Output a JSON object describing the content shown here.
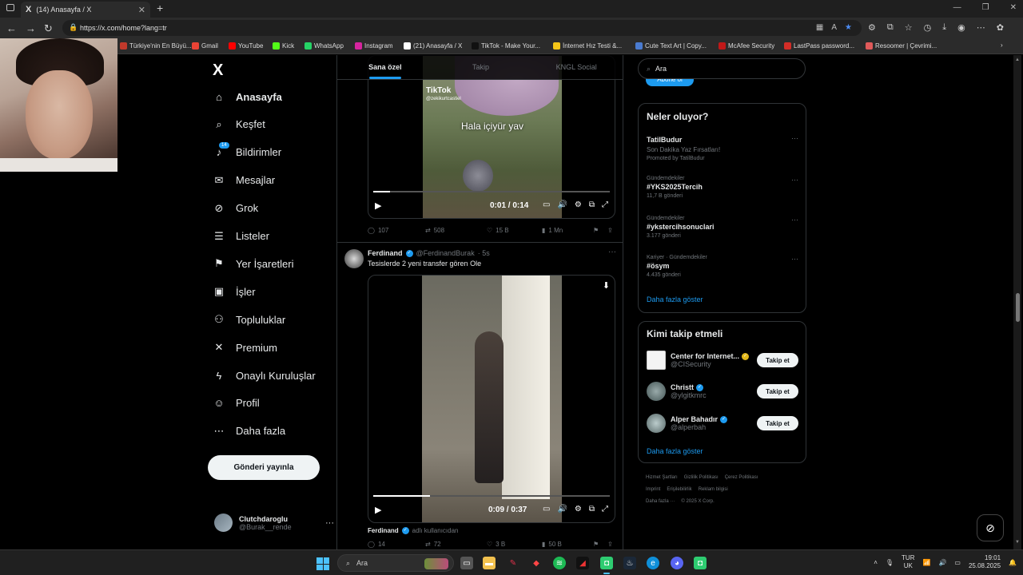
{
  "browser": {
    "tab_title": "(14) Anasayfa / X",
    "url": "https://x.com/home?lang=tr",
    "bookmarks": [
      {
        "label": "Türkiye'nin En Büyü...",
        "color": "#c0392b"
      },
      {
        "label": "Gmail",
        "color": "#ea4335"
      },
      {
        "label": "YouTube",
        "color": "#ff0000"
      },
      {
        "label": "Kick",
        "color": "#53fc18"
      },
      {
        "label": "WhatsApp",
        "color": "#25d366"
      },
      {
        "label": "Instagram",
        "color": "#d6249f"
      },
      {
        "label": "(21) Anasayfa / X",
        "color": "#ffffff"
      },
      {
        "label": "TikTok - Make Your...",
        "color": "#111111"
      },
      {
        "label": "İnternet Hız Testi &...",
        "color": "#f5c518"
      },
      {
        "label": "Cute Text Art | Copy...",
        "color": "#4a7bd0"
      },
      {
        "label": "McAfee Security",
        "color": "#c01818"
      },
      {
        "label": "LastPass password...",
        "color": "#d32d27"
      },
      {
        "label": "Resoomer | Çevrimi...",
        "color": "#e05a5a"
      }
    ]
  },
  "sidebar": {
    "logo": "X",
    "notification_count": "14",
    "items": [
      {
        "label": "Anasayfa",
        "icon": "home-icon",
        "glyph": "⌂"
      },
      {
        "label": "Keşfet",
        "icon": "search-icon",
        "glyph": "⌕"
      },
      {
        "label": "Bildirimler",
        "icon": "bell-icon",
        "glyph": "♪"
      },
      {
        "label": "Mesajlar",
        "icon": "mail-icon",
        "glyph": "✉"
      },
      {
        "label": "Grok",
        "icon": "grok-icon",
        "glyph": "⊘"
      },
      {
        "label": "Listeler",
        "icon": "list-icon",
        "glyph": "☰"
      },
      {
        "label": "Yer İşaretleri",
        "icon": "bookmark-icon",
        "glyph": "⚑"
      },
      {
        "label": "İşler",
        "icon": "briefcase-icon",
        "glyph": "▣"
      },
      {
        "label": "Topluluklar",
        "icon": "communities-icon",
        "glyph": "⚇"
      },
      {
        "label": "Premium",
        "icon": "x-premium-icon",
        "glyph": "✕"
      },
      {
        "label": "Onaylı Kuruluşlar",
        "icon": "lightning-icon",
        "glyph": "ϟ"
      },
      {
        "label": "Profil",
        "icon": "profile-icon",
        "glyph": "☺"
      },
      {
        "label": "Daha fazla",
        "icon": "more-circle-icon",
        "glyph": "⋯"
      }
    ],
    "post_button": "Gönderi yayınla",
    "account": {
      "name": "Clutchdaroglu",
      "handle": "@Burak__rende"
    }
  },
  "feed": {
    "tabs": [
      "Sana özel",
      "Takip",
      "KNGL Social"
    ],
    "post1": {
      "tiktok_label": "TikTok",
      "tiktok_handle": "@zekikurtcastiel",
      "caption": "Hala içiyür yav",
      "time": "0:01 / 0:14",
      "progress": 0.07,
      "replies": "107",
      "reposts": "508",
      "likes": "15 B",
      "views": "1 Mn"
    },
    "post2": {
      "name": "Ferdinand",
      "handle": "@FerdinandBurak",
      "age": "· 5s",
      "text": "Tesislerde 2 yeni transfer gören Ole",
      "time": "0:09 / 0:37",
      "progress": 0.24,
      "sub_name": "Ferdinand",
      "sub_handle": "adlı kullanıcıdan",
      "replies": "14",
      "reposts": "72",
      "likes": "3 B",
      "views": "50 B"
    }
  },
  "right": {
    "search_value": "Ara",
    "subscribe_label": "Abone ol",
    "trends_title": "Neler oluyor?",
    "trends": [
      {
        "meta": "",
        "title": "TatilBudur",
        "sub": "Son Dakika Yaz Fırsatları!",
        "count": "Promoted by TatilBudur"
      },
      {
        "meta": "Gündemdekiler",
        "title": "#YKS2025Tercih",
        "sub": "",
        "count": "11,7 B gönderi"
      },
      {
        "meta": "Gündemdekiler",
        "title": "#ykstercihsonuclari",
        "sub": "",
        "count": "3.177 gönderi"
      },
      {
        "meta": "Kariyer · Gündemdekiler",
        "title": "#ösym",
        "sub": "",
        "count": "4.435 gönderi"
      }
    ],
    "trends_more": "Daha fazla göster",
    "follow_title": "Kimi takip etmeli",
    "follow": [
      {
        "name": "Center for Internet...",
        "handle": "@CISecurity",
        "badge": "gold",
        "button": "Takip et"
      },
      {
        "name": "Christt",
        "handle": "@ylgitkmrc",
        "badge": "blue",
        "button": "Takip et"
      },
      {
        "name": "Alper Bahadır",
        "handle": "@alperbah",
        "badge": "blue",
        "button": "Takip et"
      }
    ],
    "follow_more": "Daha fazla göster",
    "footer": [
      "Hizmet Şartları",
      "Gizlilik Politikası",
      "Çerez Politikası",
      "Imprint",
      "Erişilebilirlik",
      "Reklam bilgisi",
      "Daha fazla ···",
      "© 2025 X Corp."
    ]
  },
  "taskbar": {
    "search_label": "Ara",
    "lang_top": "TUR",
    "lang_bottom": "UK",
    "time": "19:01",
    "date": "25.08.2025"
  }
}
